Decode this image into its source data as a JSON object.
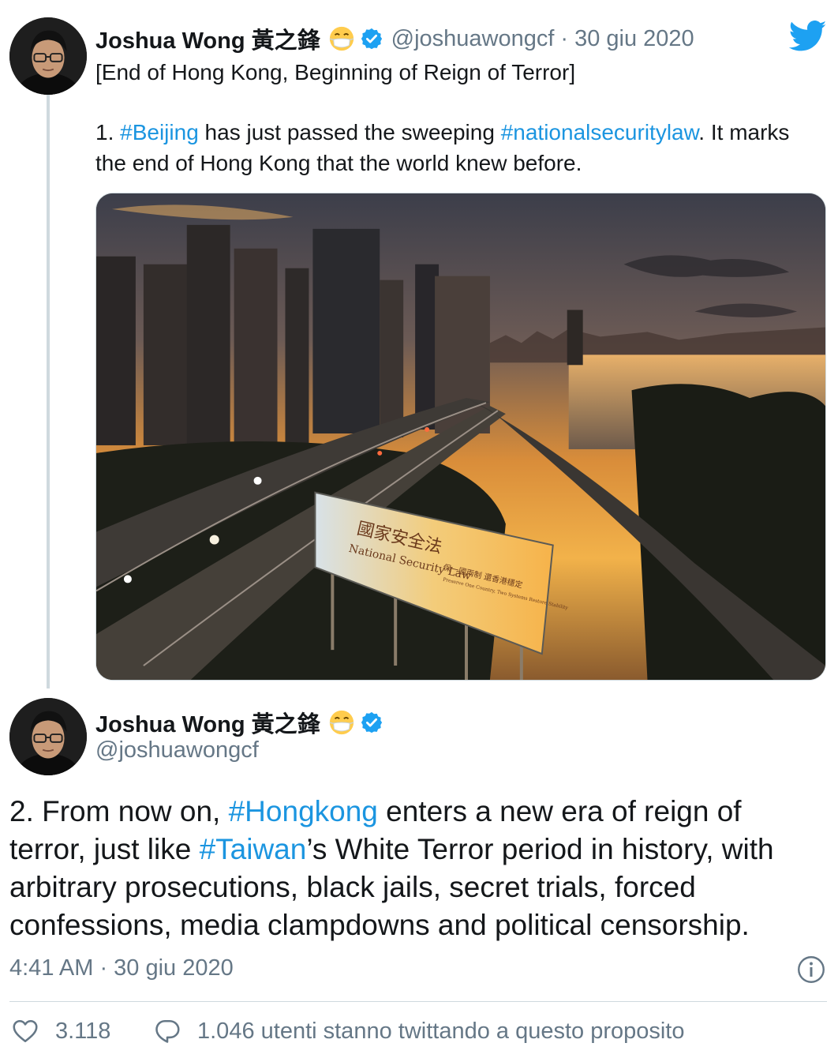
{
  "brand": {
    "icon": "twitter-bird-icon",
    "color": "#1da1f2",
    "hashtag_color": "#1b95e0"
  },
  "tweet1": {
    "author_name": "Joshua Wong 黃之鋒",
    "emoji": "face-with-medical-mask-icon",
    "verified": "verified-badge-icon",
    "handle": "@joshuawongcf",
    "separator": "·",
    "date": "30 giu 2020",
    "line1": "[End of Hong Kong, Beginning of Reign of Terror]",
    "p2_prefix": "1. ",
    "p2_tag1": "#Beijing",
    "p2_mid": " has just passed the sweeping ",
    "p2_tag2": "#nationalsecuritylaw",
    "p2_suffix": ". It marks the end of Hong Kong that the world knew before.",
    "image": {
      "billboard_cn": "國家安全法",
      "billboard_en": "National Security Law",
      "billboard_sub_cn": "保一國兩制 還香港穩定",
      "billboard_sub_en": "Preserve One Country, Two Systems  Restore Stability"
    }
  },
  "tweet2": {
    "author_name": "Joshua Wong 黃之鋒",
    "emoji": "face-with-medical-mask-icon",
    "verified": "verified-badge-icon",
    "handle": "@joshuawongcf",
    "t_prefix": "2. From now on, ",
    "t_tag1": "#Hongkong",
    "t_mid": " enters a new era of reign of terror, just like ",
    "t_tag2": "#Taiwan",
    "t_suffix": "’s White Terror period in history, with arbitrary prosecutions, black jails, secret trials, forced confessions, media clampdowns and political censorship.",
    "timestamp": "4:41 AM · 30 giu 2020",
    "likes": "3.118",
    "talking": "1.046 utenti stanno twittando a questo proposito"
  }
}
